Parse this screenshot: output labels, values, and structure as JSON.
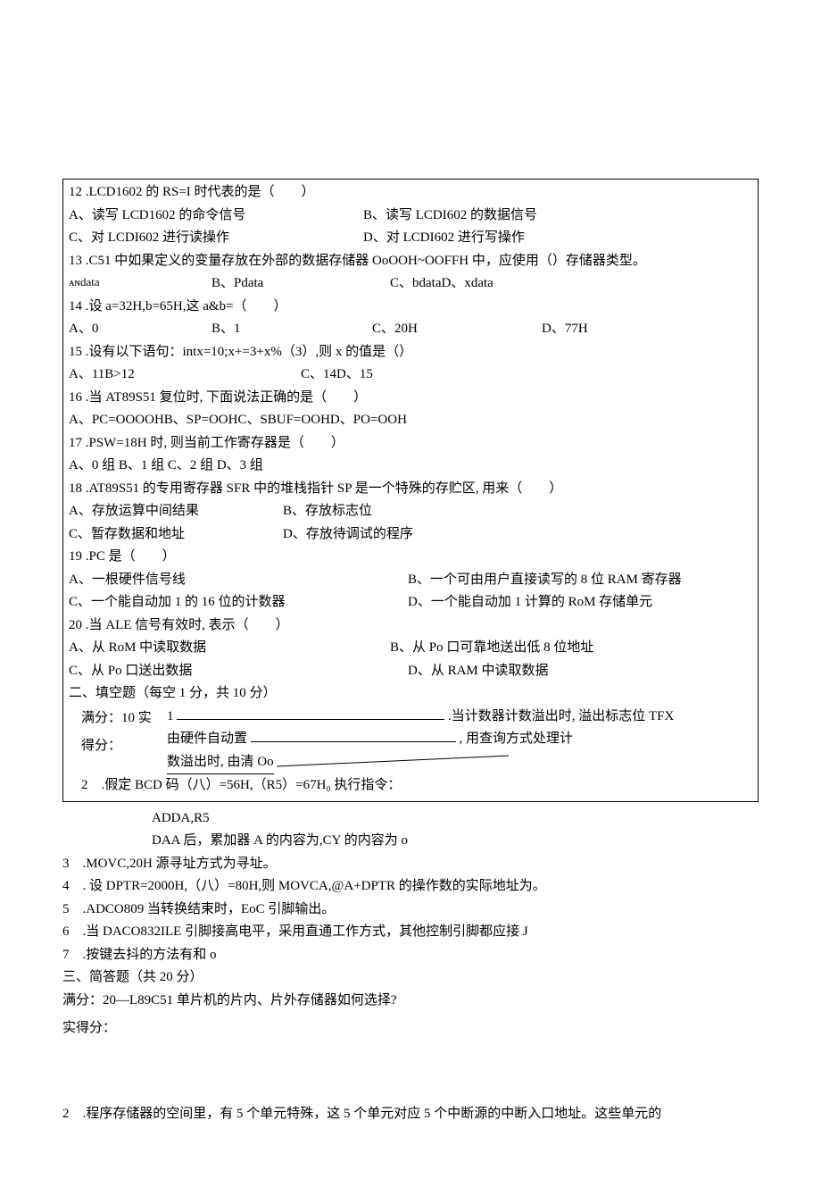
{
  "q12": {
    "stem": "12 .LCD1602 的 RS=I 时代表的是（　　）",
    "A": "A、读写 LCD1602 的命令信号",
    "B": "B、读写 LCDI602 的数据信号",
    "C": "C、对 LCDI602 进行读操作",
    "D": "D、对 LCDI602 进行写操作"
  },
  "q13": {
    "stem": "13 .C51 中如果定义的变量存放在外部的数据存储器 OoOOH~OOFFH 中，应使用（）存储器类型。",
    "A": "ᴀɴdata",
    "B": "B、Pdata",
    "C": "C、bdataD、xdata"
  },
  "q14": {
    "stem": "14 .设 a=32H,b=65H,这 a&b=（　　）",
    "A": "A、0",
    "B": "B、1",
    "C": "C、20H",
    "D": "D、77H"
  },
  "q15": {
    "stem": "15 .设有以下语句：intx=10;x+=3+x%（3）,则 x 的值是（）",
    "A": "A、11B>12",
    "C": "C、14D、15"
  },
  "q16": {
    "stem": "16 .当 AT89S51 复位时, 下面说法正确的是（　　）",
    "A": "A、PC=OOOOHB、SP=OOHC、SBUF=OOHD、PO=OOH"
  },
  "q17": {
    "stem": "17 .PSW=18H 时, 则当前工作寄存器是（　　）",
    "A": "A、0 组 B、1 组 C、2 组 D、3 组"
  },
  "q18": {
    "stem": "18 .AT89S51 的专用寄存器 SFR 中的堆栈指针 SP 是一个特殊的存贮区, 用来（　　）",
    "A": "A、存放运算中间结果",
    "B": "B、存放标志位",
    "C": "C、暂存数据和地址",
    "D": "D、存放待调试的程序"
  },
  "q19": {
    "stem": "19 .PC 是（　　）",
    "A": "A、一根硬件信号线",
    "B": "B、一个可由用户直接读写的 8 位 RAM 寄存器",
    "C": "C、一个能自动加 1 的 16 位的计数器",
    "D": "D、一个能自动加 1 计算的 RoM 存储单元"
  },
  "q20": {
    "stem": "20 .当 ALE 信号有效时, 表示（　　）",
    "A": "A、从 RoM 中读取数据",
    "B": "B、从 Po 口可靠地送出低 8 位地址",
    "C": "C、从 Po 口送出数据",
    "D": "D、从 RAM 中读取数据"
  },
  "section2": {
    "title": "二、填空题（每空 1 分，共 10 分）",
    "scoreFull": "满分：10 实",
    "scoreGet": "得分：",
    "q1a": "1",
    "q1b": ".当计数器计数溢出时, 溢出标志位 TFX",
    "q1c": "由硬件自动置",
    "q1d": ", 用查询方式处理计",
    "q1e": "数溢出时, 由清 Oo",
    "q2": "2　.假定 BCD 码（八）=56H,（R5）=67H₀ 执行指令：",
    "q2a": "ADDA,R5",
    "q2b": "DAA 后，累加器 A 的内容为,CY 的内容为 o",
    "q3": "3　.MOVC,20H 源寻址方式为寻址。",
    "q4": "4　. 设 DPTR=2000H,（八）=80H,则 MOVCA,@A+DPTR 的操作数的实际地址为。",
    "q5": "5　.ADCO809 当转换结束时，EoC 引脚输出。",
    "q6": "6　.当 DACO832ILE 引脚接高电平，采用直通工作方式，其他控制引脚都应接 J",
    "q7": "7　.按键去抖的方法有和 o"
  },
  "section3": {
    "title": "三、简答题（共 20 分）",
    "q1": "满分：20—L89C51 单片机的片内、片外存储器如何选择?",
    "score": "实得分：",
    "q2": "2　.程序存储器的空间里，有 5 个单元特殊，这 5 个单元对应 5 个中断源的中断入口地址。这些单元的"
  }
}
